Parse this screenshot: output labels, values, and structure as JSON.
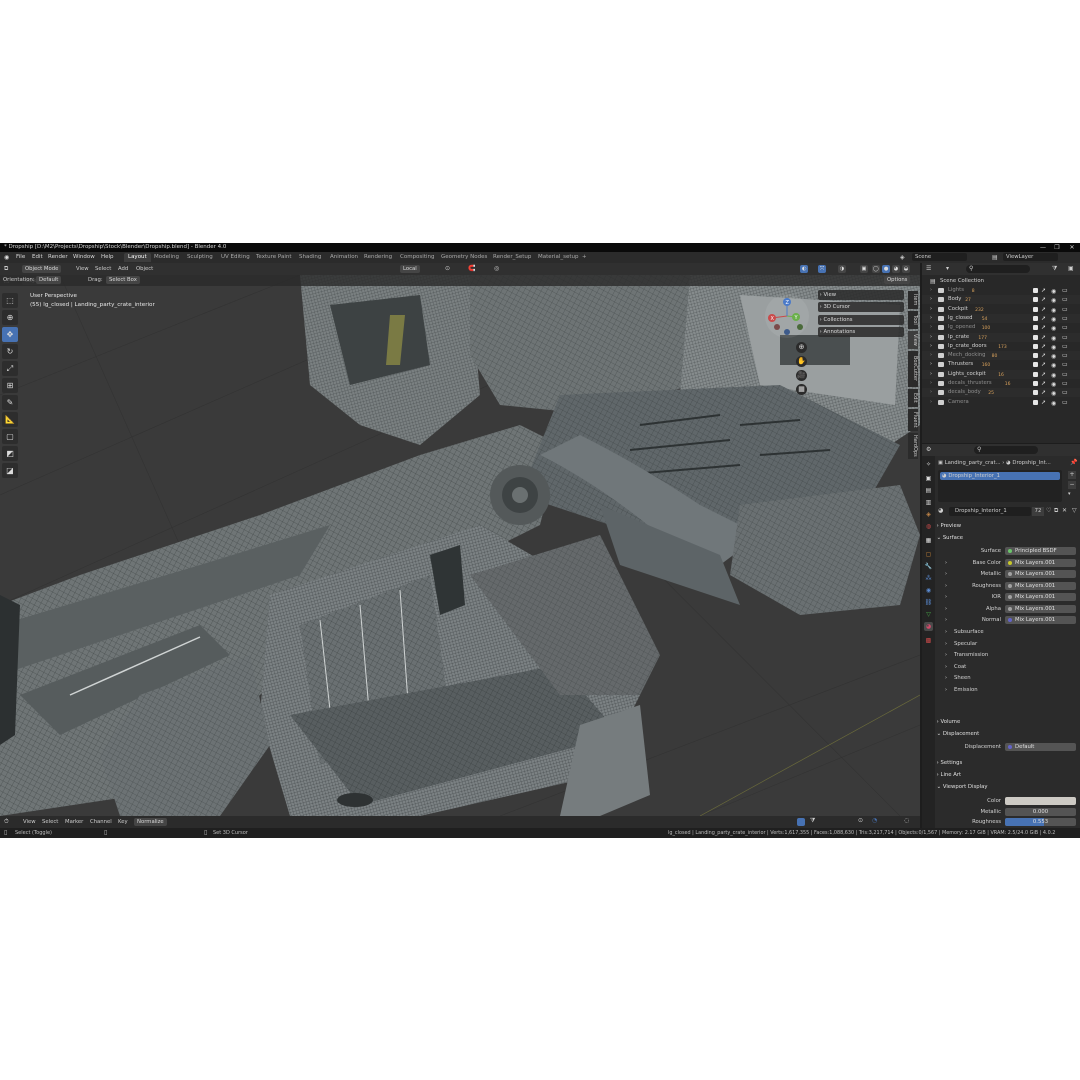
{
  "window": {
    "title": "* Dropship [D:\\M2\\Projects\\Dropship\\Stock\\Blender\\Dropship.blend] - Blender 4.0",
    "minimize": "—",
    "maximize": "❐",
    "close": "✕"
  },
  "menubar": {
    "items": [
      "File",
      "Edit",
      "Render",
      "Window",
      "Help"
    ],
    "workspaces": [
      "Layout",
      "Modeling",
      "Sculpting",
      "UV Editing",
      "Texture Paint",
      "Shading",
      "Animation",
      "Rendering",
      "Compositing",
      "Geometry Nodes",
      "Render_Setup",
      "Material_setup"
    ],
    "active_workspace": "Layout",
    "add_workspace": "+",
    "scene_label": "Scene",
    "view_layer_label": "ViewLayer"
  },
  "viewport_header": {
    "mode": "Object Mode",
    "menus": [
      "View",
      "Select",
      "Add",
      "Object"
    ],
    "transform_orientation": "Local",
    "orientation_label": "Orientation:",
    "orientation_value": "Default",
    "drag_label": "Drag:",
    "drag_value": "Select Box",
    "options": "Options"
  },
  "viewport": {
    "perspective_label": "User Perspective",
    "object_info": "(55) lg_closed | Landing_party_crate_interior",
    "gizmo_axes": {
      "x": "X",
      "y": "Y",
      "z": "Z"
    },
    "npanel": [
      "View",
      "3D Cursor",
      "Collections",
      "Annotations"
    ],
    "side_tabs": [
      "Item",
      "Tool",
      "View",
      "BoxCutter",
      "Edit",
      "Fluent",
      "HardOps"
    ]
  },
  "toolbar": {
    "tools": [
      "select-box",
      "cursor",
      "move",
      "rotate",
      "scale",
      "transform",
      "annotate",
      "measure",
      "add-cube",
      "bevel",
      "extrude"
    ],
    "active_tool": "move"
  },
  "timeline": {
    "menus": [
      "View",
      "Select",
      "Marker",
      "Channel",
      "Key"
    ],
    "normalize": "Normalize"
  },
  "status_bar": {
    "left_action": "Select (Toggle)",
    "middle_action": "Set 3D Cursor",
    "stats": "lg_closed | Landing_party_crate_interior | Verts:1,617,355 | Faces:1,088,630 | Tris:3,217,714 | Objects:0/1,567 | Memory: 2.17 GiB | VRAM: 2.5/24.0 GiB | 4.0.2"
  },
  "outliner": {
    "root": "Scene Collection",
    "collections": [
      {
        "name": "Lights",
        "count": "8",
        "dim": true
      },
      {
        "name": "Body",
        "count": "27",
        "dim": false
      },
      {
        "name": "Cockpit",
        "count": "232",
        "dim": false
      },
      {
        "name": "lg_closed",
        "count": "54",
        "dim": false
      },
      {
        "name": "lg_opened",
        "count": "100",
        "dim": true
      },
      {
        "name": "lp_crate",
        "count": "177",
        "dim": false
      },
      {
        "name": "lp_crate_doors",
        "count": "173",
        "dim": false
      },
      {
        "name": "Mech_docking",
        "count": "80",
        "dim": true
      },
      {
        "name": "Thrusters",
        "count": "160",
        "dim": false
      },
      {
        "name": "Lights_cockpit",
        "count": "16",
        "dim": false
      },
      {
        "name": "decals_thrusters",
        "count": "16",
        "dim": true
      },
      {
        "name": "decals_body",
        "count": "25",
        "dim": true
      },
      {
        "name": "Camera",
        "count": "",
        "dim": true
      }
    ]
  },
  "properties": {
    "breadcrumb_object": "Landing_party_crat...",
    "breadcrumb_material": "Dropship_Int...",
    "material_slot": "Dropship_Interior_1",
    "material_name": "Dropship_Interior_1",
    "user_count": "72",
    "sections": {
      "preview": "Preview",
      "surface": "Surface",
      "volume": "Volume",
      "displacement": "Displacement",
      "settings": "Settings",
      "line_art": "Line Art",
      "viewport_display": "Viewport Display"
    },
    "surface_rows": [
      {
        "label": "Surface",
        "value": "Principled BSDF",
        "color": "#6bc46b"
      },
      {
        "label": "Base Color",
        "value": "Mix Layers.001",
        "color": "#c7c729"
      },
      {
        "label": "Metallic",
        "value": "Mix Layers.001",
        "color": "#a1a1a1"
      },
      {
        "label": "Roughness",
        "value": "Mix Layers.001",
        "color": "#a1a1a1"
      },
      {
        "label": "IOR",
        "value": "Mix Layers.001",
        "color": "#a1a1a1"
      },
      {
        "label": "Alpha",
        "value": "Mix Layers.001",
        "color": "#a1a1a1"
      },
      {
        "label": "Normal",
        "value": "Mix Layers.001",
        "color": "#6363c7"
      }
    ],
    "subpanels": [
      "Subsurface",
      "Specular",
      "Transmission",
      "Coat",
      "Sheen",
      "Emission"
    ],
    "displacement_row": {
      "label": "Displacement",
      "value": "Default",
      "color": "#6363c7"
    },
    "viewport_display_rows": {
      "color_label": "Color",
      "metallic_label": "Metallic",
      "metallic_value": "0.000",
      "roughness_label": "Roughness",
      "roughness_value": "0.553",
      "roughness_fraction": 0.553
    }
  },
  "colors": {
    "accent": "#4772b3",
    "viewport_bg": "#3b3b3b",
    "panel_bg": "#2b2b2b",
    "collection_badge": "#d9a25c"
  }
}
